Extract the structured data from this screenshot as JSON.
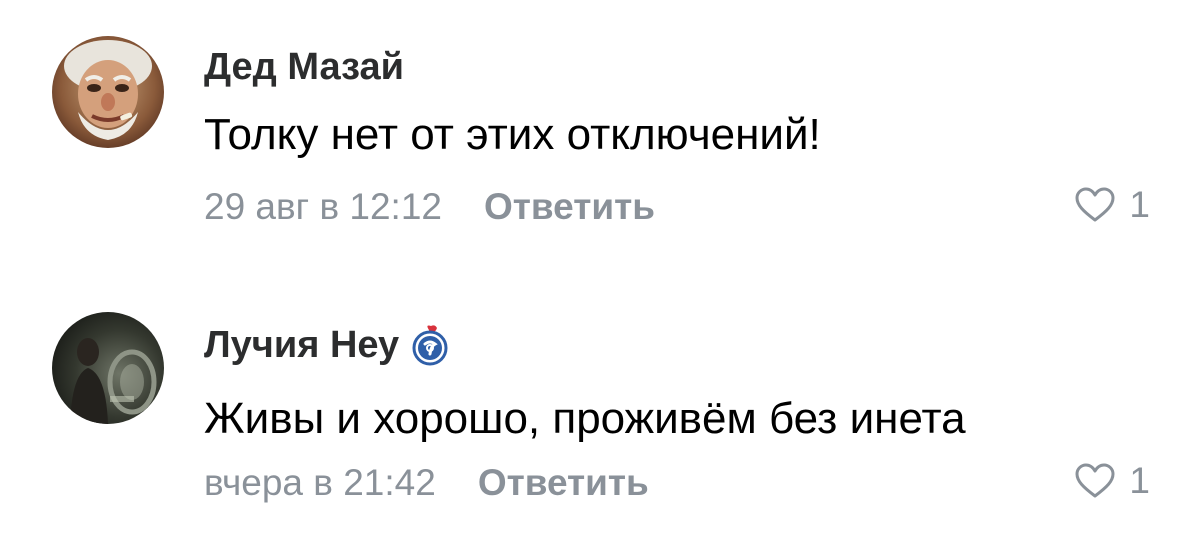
{
  "comments": [
    {
      "author": "Дед Мазай",
      "text": "Толку нет от этих отключений!",
      "date": "29 авг в 12:12",
      "reply_label": "Ответить",
      "likes": "1",
      "avatar_icon": "old-man-photo"
    },
    {
      "author": "Лучия Неу",
      "text": "Живы и хорошо, проживём без инета",
      "date": "вчера в 21:42",
      "reply_label": "Ответить",
      "likes": "1",
      "avatar_icon": "dark-photo",
      "badge_icon": "verified-club-icon"
    }
  ],
  "colors": {
    "meta": "#8a9199",
    "author": "#2c2d2e",
    "text": "#000000",
    "badge_blue": "#2f5fa8",
    "badge_red": "#d8323c"
  }
}
